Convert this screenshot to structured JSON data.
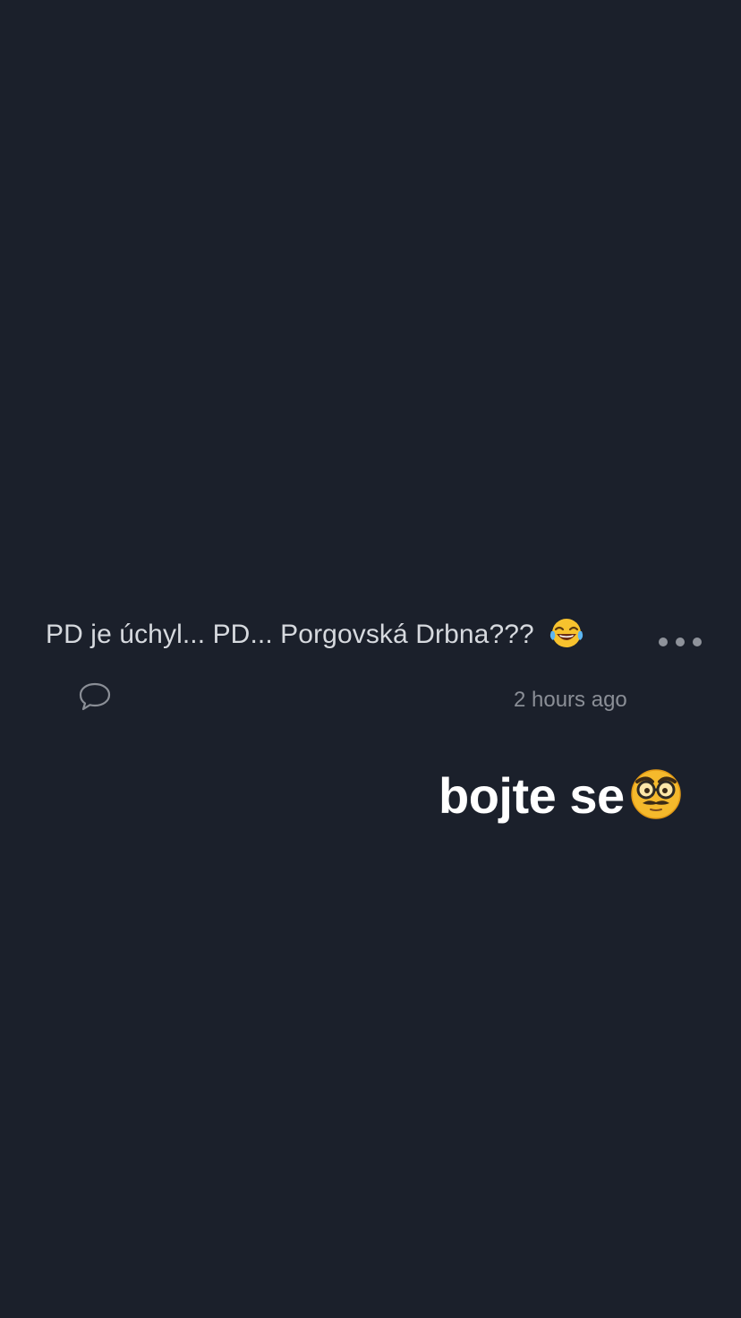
{
  "post": {
    "text": "PD je úchyl... PD... Porgovská Drbna???",
    "emoji": "face-with-tears-of-joy-icon",
    "timestamp": "2 hours ago"
  },
  "sticker": {
    "text": "bojte se",
    "emoji": "disguised-face-icon"
  },
  "colors": {
    "background": "#1b202b",
    "post_text": "#d6d9de",
    "muted": "#8a8e96",
    "sticker_text": "#ffffff"
  }
}
